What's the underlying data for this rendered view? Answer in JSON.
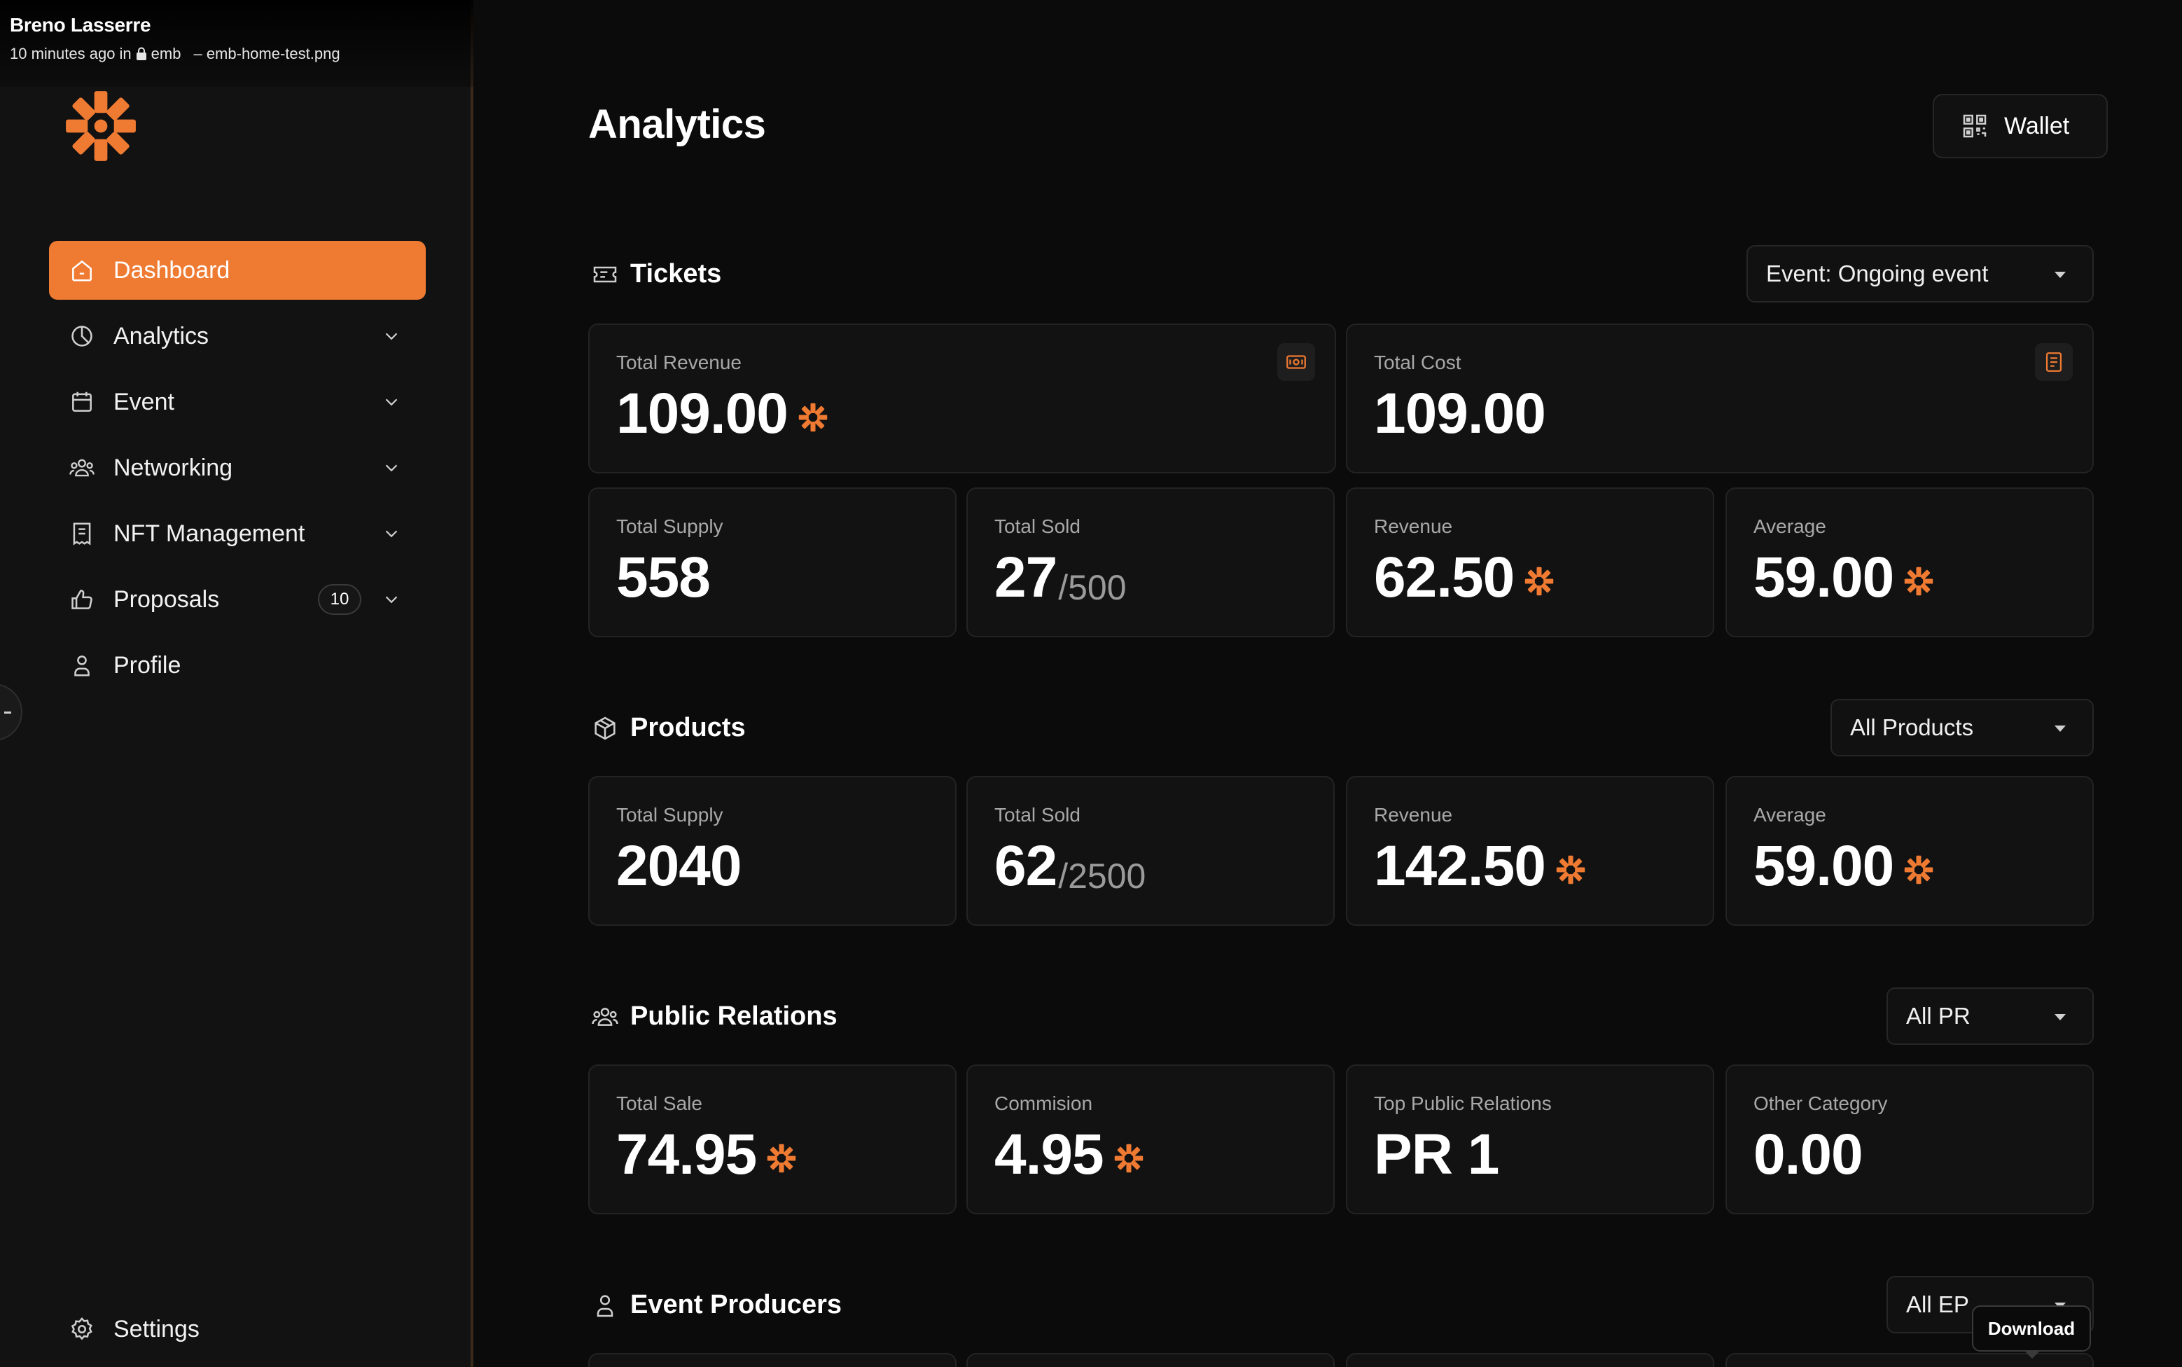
{
  "caption": {
    "author": "Breno Lasserre",
    "time_prefix": "10 minutes ago in",
    "workspace": "emb",
    "file": "– emb-home-test.png"
  },
  "sidebar": {
    "items": [
      {
        "label": "Dashboard",
        "icon": "home-icon",
        "active": true
      },
      {
        "label": "Analytics",
        "icon": "pie-chart-icon"
      },
      {
        "label": "Event",
        "icon": "calendar-icon"
      },
      {
        "label": "Networking",
        "icon": "users-icon"
      },
      {
        "label": "NFT Management",
        "icon": "receipt-icon"
      },
      {
        "label": "Proposals",
        "icon": "thumbs-up-icon",
        "badge": "10"
      },
      {
        "label": "Profile",
        "icon": "user-icon"
      }
    ],
    "settings_label": "Settings"
  },
  "header": {
    "title": "Analytics",
    "wallet_label": "Wallet"
  },
  "tickets": {
    "title": "Tickets",
    "filter": "Event: Ongoing event",
    "total_revenue": {
      "label": "Total Revenue",
      "value": "109.00"
    },
    "total_cost": {
      "label": "Total Cost",
      "value": "109.00"
    },
    "total_supply": {
      "label": "Total Supply",
      "value": "558"
    },
    "total_sold": {
      "label": "Total Sold",
      "value": "27",
      "suffix": "/500"
    },
    "revenue": {
      "label": "Revenue",
      "value": "62.50"
    },
    "average": {
      "label": "Average",
      "value": "59.00"
    }
  },
  "products": {
    "title": "Products",
    "filter": "All Products",
    "total_supply": {
      "label": "Total Supply",
      "value": "2040"
    },
    "total_sold": {
      "label": "Total Sold",
      "value": "62",
      "suffix": "/2500"
    },
    "revenue": {
      "label": "Revenue",
      "value": "142.50"
    },
    "average": {
      "label": "Average",
      "value": "59.00"
    }
  },
  "public_relations": {
    "title": "Public Relations",
    "filter": "All PR",
    "total_sale": {
      "label": "Total Sale",
      "value": "74.95"
    },
    "commission": {
      "label": "Commision",
      "value": "4.95"
    },
    "top_pr": {
      "label": "Top Public Relations",
      "value": "PR 1"
    },
    "other_category": {
      "label": "Other Category",
      "value": "0.00"
    }
  },
  "event_producers": {
    "title": "Event Producers",
    "filter": "All EP"
  },
  "tooltip": "Download",
  "colors": {
    "accent": "#ef7a32",
    "background": "#0b0b0b",
    "card": "#121212"
  }
}
